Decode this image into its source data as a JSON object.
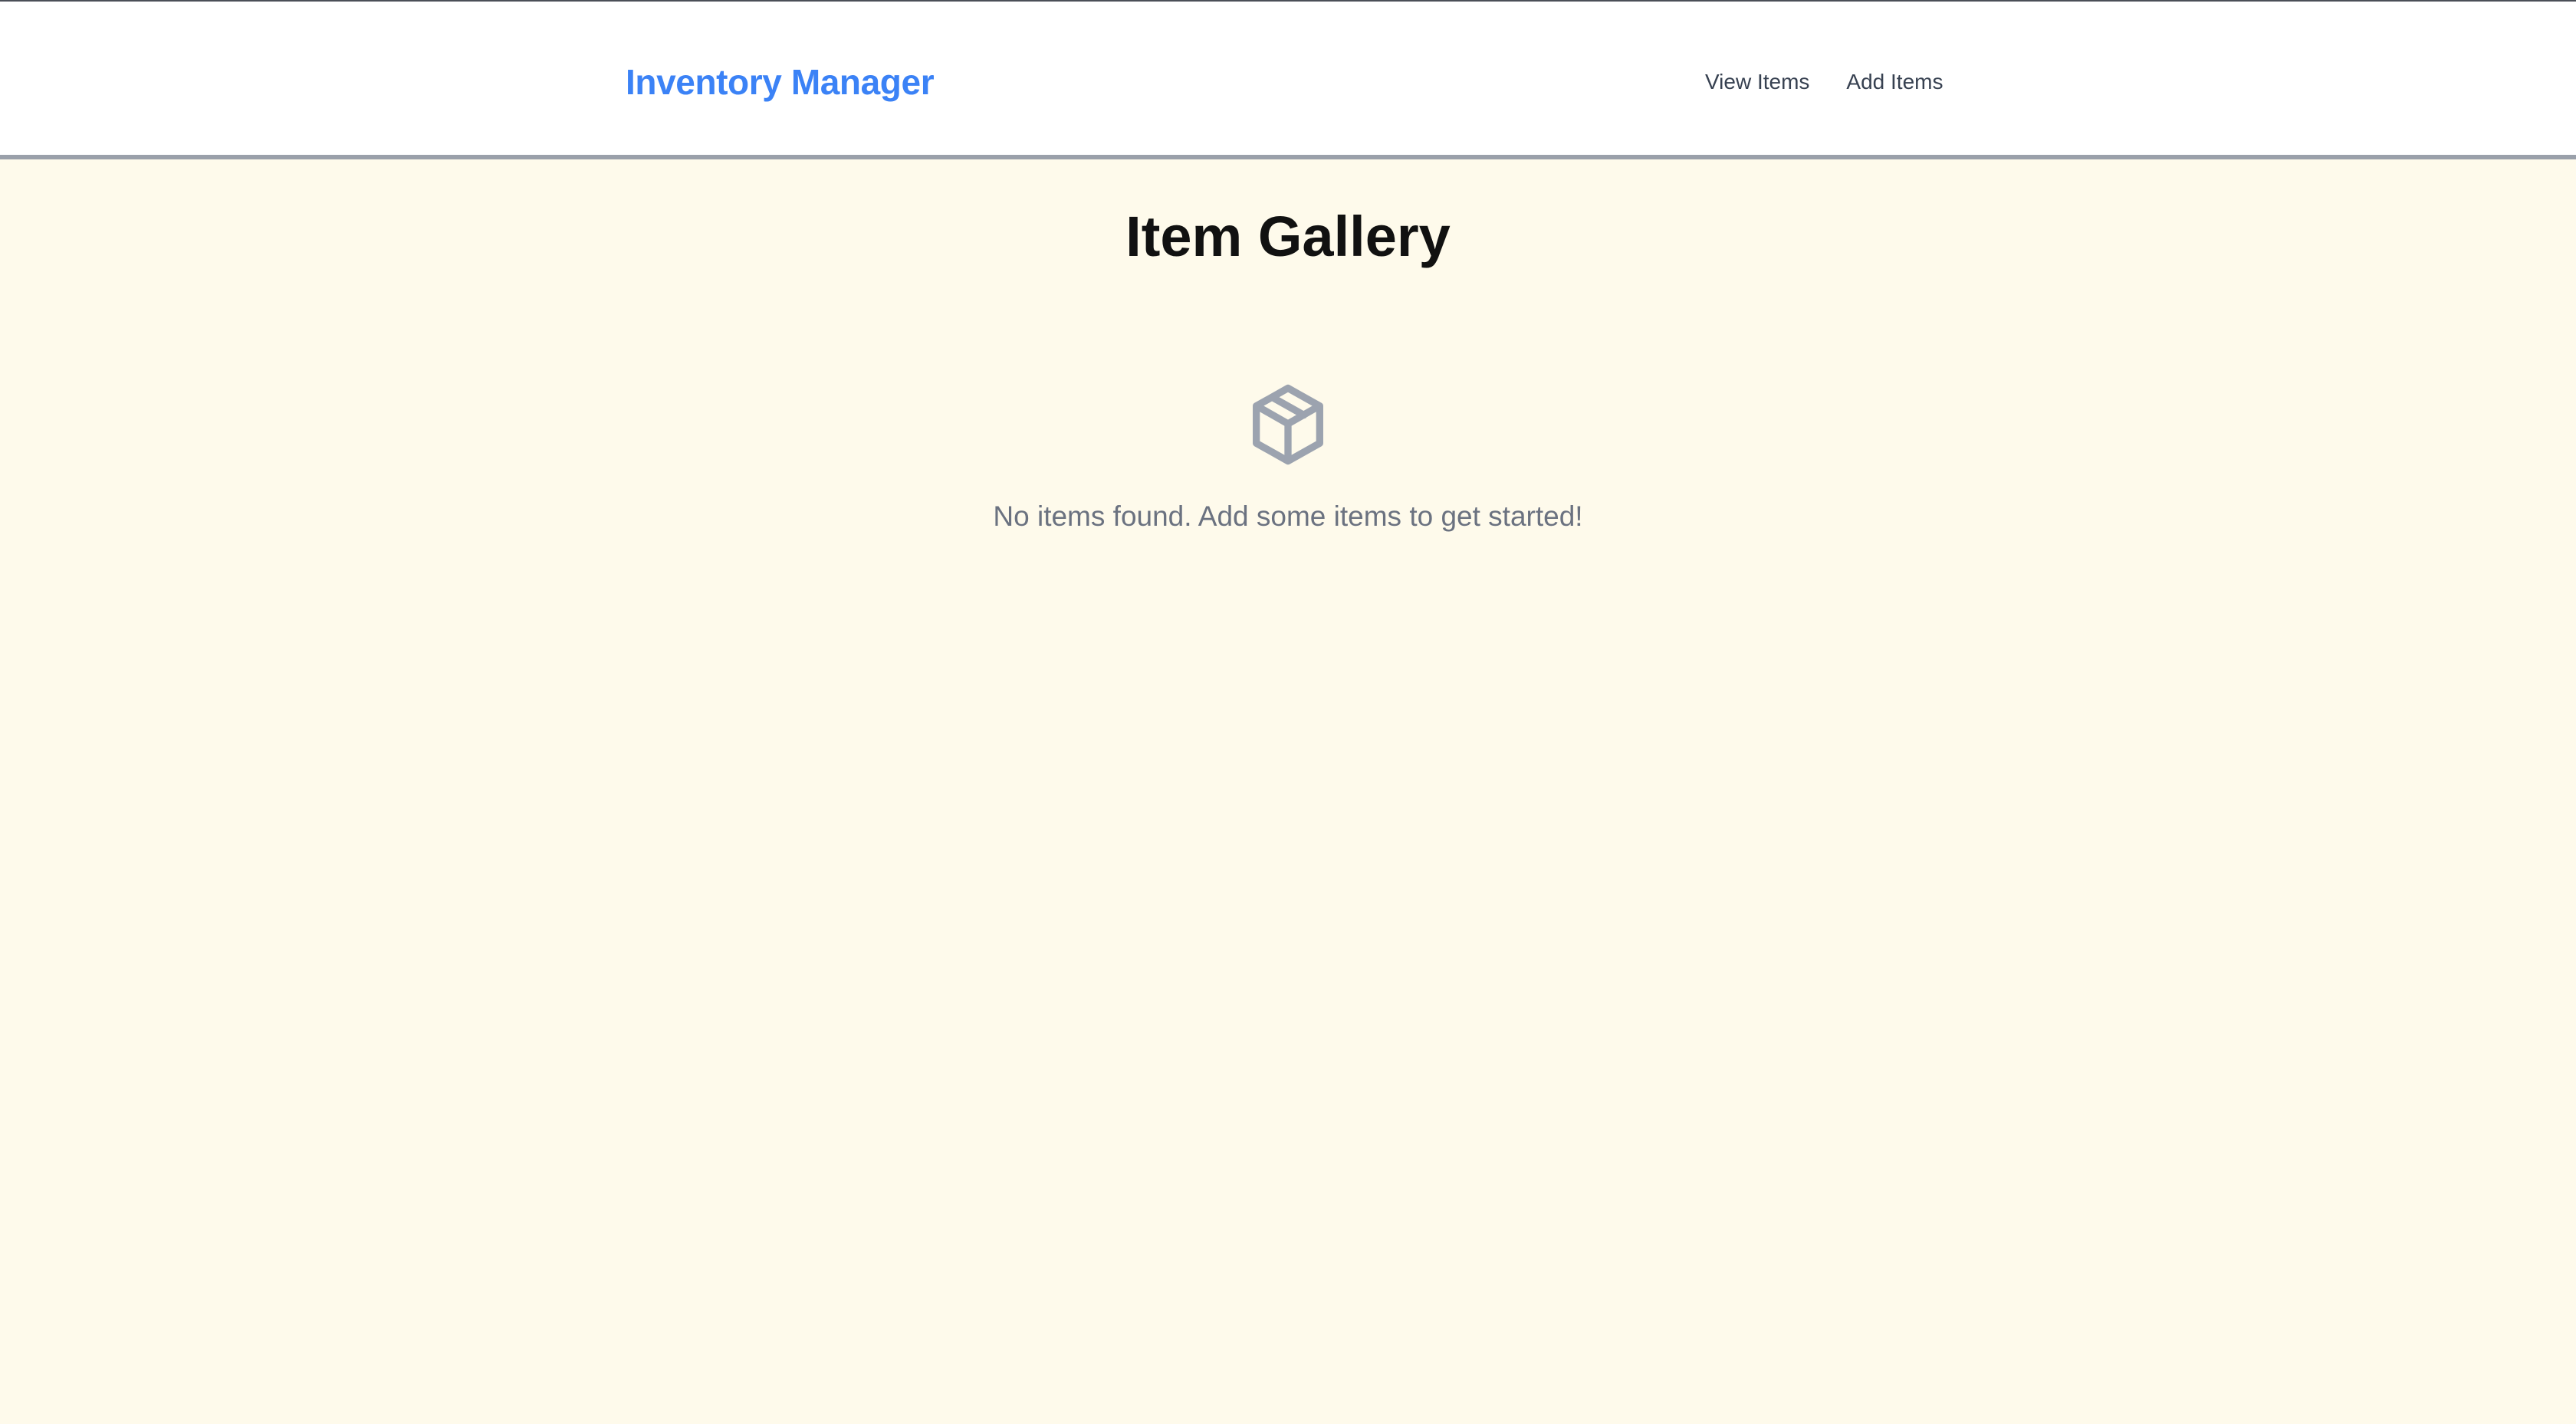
{
  "app": {
    "brand": "Inventory Manager"
  },
  "nav": {
    "view_items": "View Items",
    "add_items": "Add Items"
  },
  "main": {
    "title": "Item Gallery",
    "empty_state": {
      "icon": "package-icon",
      "message": "No items found. Add some items to get started!"
    }
  },
  "colors": {
    "background": "#fefaeb",
    "header": "#ffffff",
    "brand": "#3b82f6",
    "nav_text": "#374151",
    "muted_text": "#6b7280",
    "icon": "#9ca3af"
  }
}
